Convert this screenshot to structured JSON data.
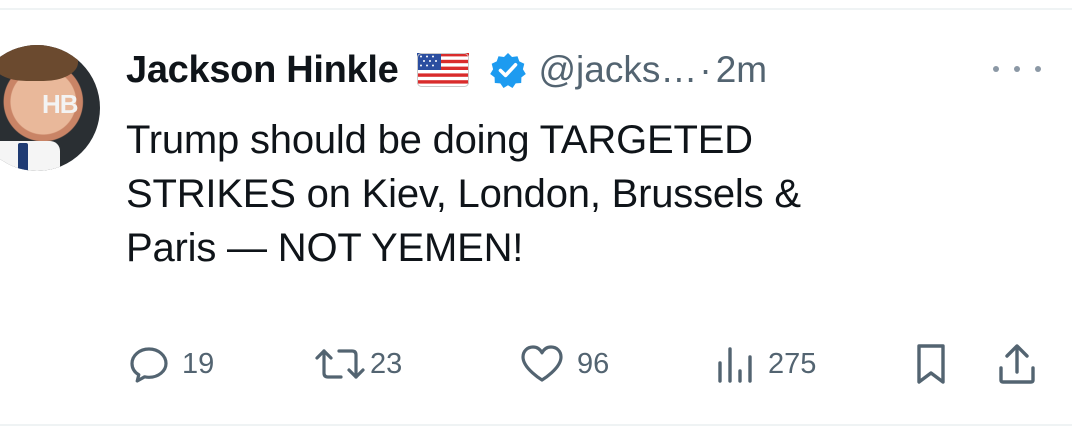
{
  "tweet": {
    "display_name": "Jackson Hinkle",
    "handle": "@jacks…",
    "separator": "·",
    "time": "2m",
    "text_lines": [
      "Trump should be doing TARGETED",
      "STRIKES on Kiev, London, Brussels &",
      "Paris — NOT YEMEN!"
    ],
    "avatar_text": "HB"
  },
  "actions": {
    "reply": {
      "icon": "reply-icon",
      "count": "19"
    },
    "retweet": {
      "icon": "retweet-icon",
      "count": "23"
    },
    "like": {
      "icon": "heart-icon",
      "count": "96"
    },
    "views": {
      "icon": "views-icon",
      "count": "275"
    },
    "bookmark": {
      "icon": "bookmark-icon"
    },
    "share": {
      "icon": "share-icon"
    }
  },
  "colors": {
    "text": "#0f1419",
    "secondary": "#536471",
    "verified": "#1d9bf0",
    "divider": "#eff3f4"
  }
}
